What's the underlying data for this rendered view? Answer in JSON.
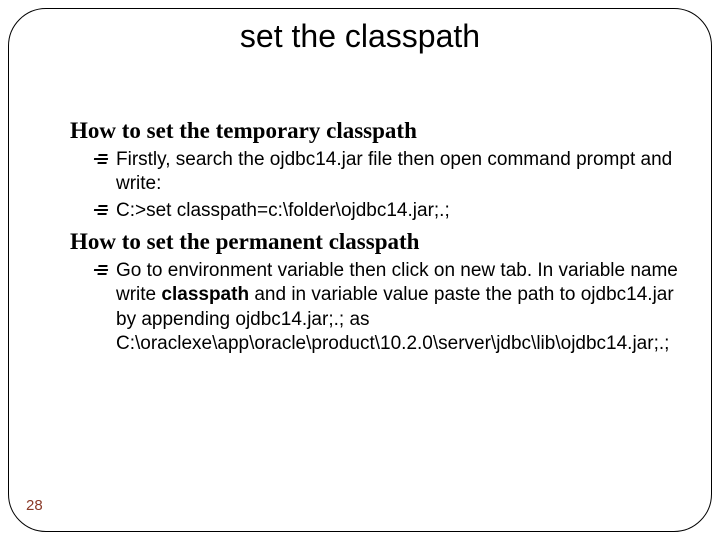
{
  "title": "set the classpath",
  "sections": [
    {
      "heading": "How to set the temporary classpath",
      "bullets": [
        {
          "text": "Firstly, search the ojdbc14.jar file then open command prompt and write:"
        },
        {
          "text": "C:>set classpath=c:\\folder\\ojdbc14.jar;.;"
        }
      ]
    },
    {
      "heading": "How to set the permanent classpath",
      "bullets": [
        {
          "pre": "Go to environment variable then click on new tab. In variable name write ",
          "bold": "classpath",
          "post": " and in variable value paste the path to ojdbc14.jar by appending ojdbc14.jar;.; as C:\\oraclexe\\app\\oracle\\product\\10.2.0\\server\\jdbc\\lib\\ojdbc14.jar;.;"
        }
      ]
    }
  ],
  "page_number": "28"
}
